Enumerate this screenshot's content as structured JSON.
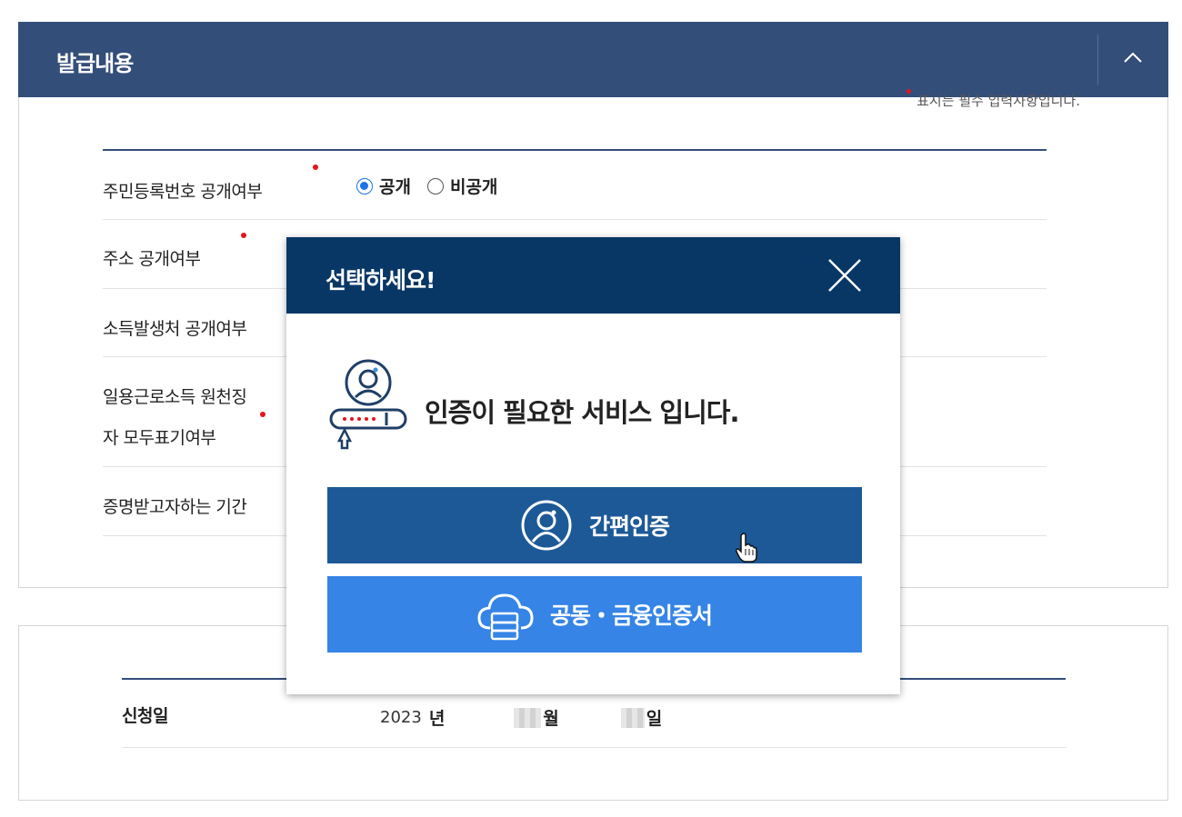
{
  "section": {
    "title": "발급내용",
    "collapse_icon": "chevron-up-icon",
    "required_note": "표시는 필수 입력사항입니다.",
    "rows": [
      {
        "label": "주민등록번호 공개여부"
      },
      {
        "label": "주소 공개여부"
      },
      {
        "label": "소득발생처 공개여부"
      },
      {
        "label_line1": "일용근로소득 원천징",
        "label_line2": "자 모두표기여부"
      },
      {
        "label": "증명받고자하는 기간"
      }
    ],
    "radio_options": [
      {
        "label": "공개",
        "checked": true
      },
      {
        "label": "비공개",
        "checked": false
      }
    ]
  },
  "application": {
    "label": "신청일",
    "year": "2023",
    "year_unit": "년",
    "month_unit": "월",
    "day_unit": "일"
  },
  "modal": {
    "title": "선택하세요!",
    "close_icon": "close-icon",
    "message": "인증이 필요한 서비스 입니다.",
    "buttons": {
      "simple_auth": "간편인증",
      "certificate": "공동・금융인증서"
    }
  },
  "colors": {
    "section_header": "#344e7a",
    "modal_header": "#083766",
    "simple_button": "#1d5997",
    "certificate_button": "#3584e6",
    "required_dot": "#e4141b"
  }
}
